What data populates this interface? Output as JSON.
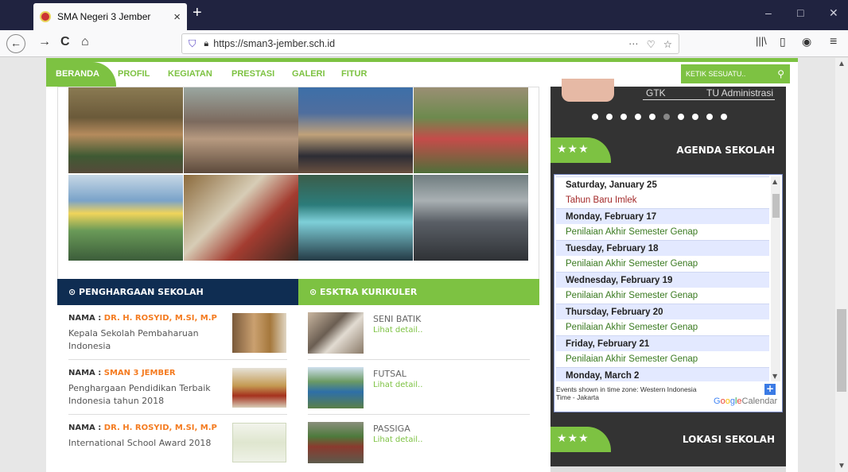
{
  "browser": {
    "tab_title": "SMA Negeri 3 Jember",
    "tab_close": "×",
    "new_tab": "+",
    "url": "https://sman3-jember.sch.id",
    "back": "←",
    "forward": "→",
    "reload": "C",
    "home": "⌂",
    "more": "···",
    "pocket": "♡",
    "star": "☆",
    "library": "|||\\",
    "sidebar": "▯",
    "account": "◉",
    "menu": "≡",
    "minimize": "–",
    "maximize": "□",
    "close": "✕"
  },
  "nav": {
    "items": [
      "BERANDA",
      "PROFIL",
      "KEGIATAN",
      "PRESTASI",
      "GALERI",
      "FITUR"
    ],
    "search_placeholder": "KETIK SESUATU..",
    "search_icon": "search-icon"
  },
  "awards": {
    "heading": "⊙ PENGHARGAAN SEKOLAH",
    "label": "NAMA :",
    "items": [
      {
        "name": "DR. H. ROSYID, M.SI, M.P",
        "desc": "Kepala Sekolah Pembaharuan Indonesia"
      },
      {
        "name": "SMAN 3 JEMBER",
        "desc": "Penghargaan Pendidikan Terbaik Indonesia tahun 2018"
      },
      {
        "name": "DR. H. ROSYID, M.SI, M.P",
        "desc": "International School Award 2018"
      }
    ]
  },
  "ekstra": {
    "heading": "⊙ ESKTRA KURIKULER",
    "link_label": "Lihat detail..",
    "items": [
      "SENI BATIK",
      "FUTSAL",
      "PASSIGA"
    ]
  },
  "sidebar": {
    "gtk_label": "GTK",
    "tu_label": "TU Administrasi",
    "slide_count": 10,
    "active_slide": 5,
    "stars": "★★★",
    "agenda_title": "AGENDA SEKOLAH",
    "location_title": "LOKASI SEKOLAH"
  },
  "calendar": {
    "days": [
      {
        "date": "Saturday, January 25",
        "events": [
          "Tahun Baru Imlek"
        ],
        "red": true
      },
      {
        "date": "Monday, February 17",
        "events": [
          "Penilaian Akhir Semester Genap"
        ]
      },
      {
        "date": "Tuesday, February 18",
        "events": [
          "Penilaian Akhir Semester Genap"
        ]
      },
      {
        "date": "Wednesday, February 19",
        "events": [
          "Penilaian Akhir Semester Genap"
        ]
      },
      {
        "date": "Thursday, February 20",
        "events": [
          "Penilaian Akhir Semester Genap"
        ]
      },
      {
        "date": "Friday, February 21",
        "events": [
          "Penilaian Akhir Semester Genap"
        ]
      },
      {
        "date": "Monday, March 2",
        "events": []
      }
    ],
    "timezone_note": "Events shown in time zone: Western Indonesia Time - Jakarta",
    "brand": "Google",
    "brand_suffix": "Calendar",
    "add": "+"
  },
  "colors": {
    "accent": "#7dc242",
    "navy": "#0f2d52",
    "dark": "#333333",
    "orange": "#f47b20"
  }
}
